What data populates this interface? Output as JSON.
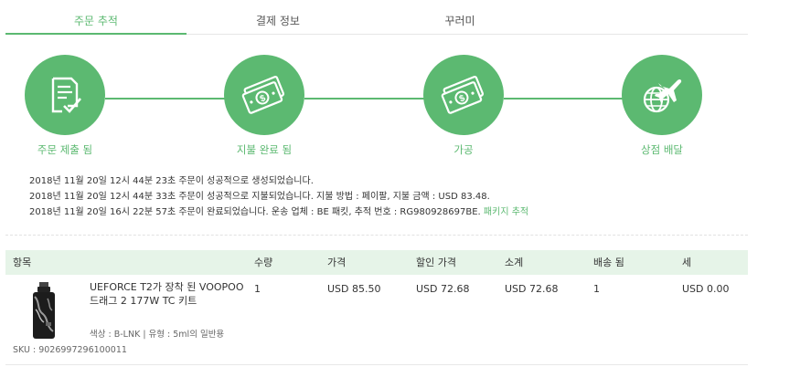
{
  "tabs": [
    {
      "label": "주문 추적"
    },
    {
      "label": "결제 정보"
    },
    {
      "label": "꾸러미"
    }
  ],
  "steps": [
    {
      "label": "주문 제출 됨",
      "icon": "order-submitted-icon"
    },
    {
      "label": "지불 완료 됨",
      "icon": "money-icon"
    },
    {
      "label": "가공",
      "icon": "money-icon"
    },
    {
      "label": "상점 배달",
      "icon": "globe-airplane-icon"
    }
  ],
  "log": {
    "line1": "2018년 11월 20일 12시 44분 23초 주문이 성공적으로 생성되었습니다.",
    "line2": "2018년 11월 20일 12시 44분 33초 주문이 성공적으로 지불되었습니다. 지불 방법 : 페이팔, 지불 금액 : USD 83.48.",
    "line3": "2018년 11월 20일 16시 22분 57초 주문이 완료되었습니다. 운송 업체 : BE 패킷, 추적 번호 : RG980928697BE.",
    "track_link": "패키지 추적"
  },
  "table": {
    "headers": {
      "item": "항목",
      "qty": "수량",
      "price": "가격",
      "discount": "할인 가격",
      "subtotal": "소계",
      "shipped": "배송 됨",
      "tax": "세"
    },
    "row": {
      "name": "UEFORCE T2가 장착 된 VOOPOO 드래그 2 177W TC 키트",
      "meta": "색상 : B-LNK | 유형 : 5ml의 일반용",
      "sku": "SKU : 9026997296100011",
      "qty": "1",
      "price": "USD 85.50",
      "discount": "USD 72.68",
      "subtotal": "USD 72.68",
      "shipped": "1",
      "tax": "USD 0.00"
    }
  },
  "colors": {
    "accent": "#5cb971",
    "header_bg": "#e6f4e8"
  }
}
